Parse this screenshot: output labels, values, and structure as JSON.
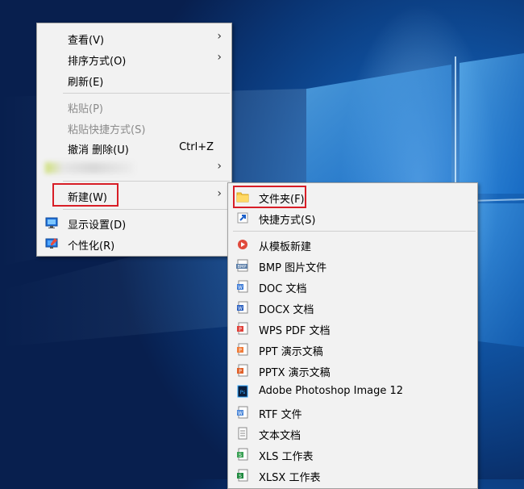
{
  "context_menu": {
    "items": [
      {
        "label": "查看(V)",
        "has_submenu": true,
        "enabled": true
      },
      {
        "label": "排序方式(O)",
        "has_submenu": true,
        "enabled": true
      },
      {
        "label": "刷新(E)",
        "has_submenu": false,
        "enabled": true
      },
      {
        "label": "粘贴(P)",
        "has_submenu": false,
        "enabled": false
      },
      {
        "label": "粘贴快捷方式(S)",
        "has_submenu": false,
        "enabled": false
      },
      {
        "label": "撤消 删除(U)",
        "shortcut": "Ctrl+Z",
        "has_submenu": false,
        "enabled": true
      },
      {
        "label": "",
        "has_submenu": true,
        "enabled": true,
        "blurred": true
      },
      {
        "label": "新建(W)",
        "has_submenu": true,
        "enabled": true,
        "highlighted": true
      },
      {
        "label": "显示设置(D)",
        "icon": "display-settings-icon",
        "has_submenu": false,
        "enabled": true
      },
      {
        "label": "个性化(R)",
        "icon": "personalize-icon",
        "has_submenu": false,
        "enabled": true
      }
    ],
    "arrow_glyph": "›"
  },
  "new_submenu": {
    "items": [
      {
        "label": "文件夹(F)",
        "icon": "folder-icon",
        "highlighted": true
      },
      {
        "label": "快捷方式(S)",
        "icon": "shortcut-icon"
      },
      {
        "label": "从模板新建",
        "icon": "template-icon"
      },
      {
        "label": "BMP 图片文件",
        "icon": "bmp-icon"
      },
      {
        "label": "DOC 文档",
        "icon": "doc-icon"
      },
      {
        "label": "DOCX 文档",
        "icon": "docx-icon"
      },
      {
        "label": "WPS PDF 文档",
        "icon": "pdf-icon"
      },
      {
        "label": "PPT 演示文稿",
        "icon": "ppt-icon"
      },
      {
        "label": "PPTX 演示文稿",
        "icon": "pptx-icon"
      },
      {
        "label": "Adobe Photoshop Image 12",
        "icon": "photoshop-icon"
      },
      {
        "label": "RTF 文件",
        "icon": "rtf-icon"
      },
      {
        "label": "文本文档",
        "icon": "text-document-icon"
      },
      {
        "label": "XLS 工作表",
        "icon": "xls-icon"
      },
      {
        "label": "XLSX 工作表",
        "icon": "xlsx-icon"
      }
    ]
  },
  "colors": {
    "highlight_box": "#d81e27",
    "menu_bg": "#f2f2f2",
    "disabled_text": "#8b8b8b",
    "desktop_blue": "#0f4f9c"
  }
}
